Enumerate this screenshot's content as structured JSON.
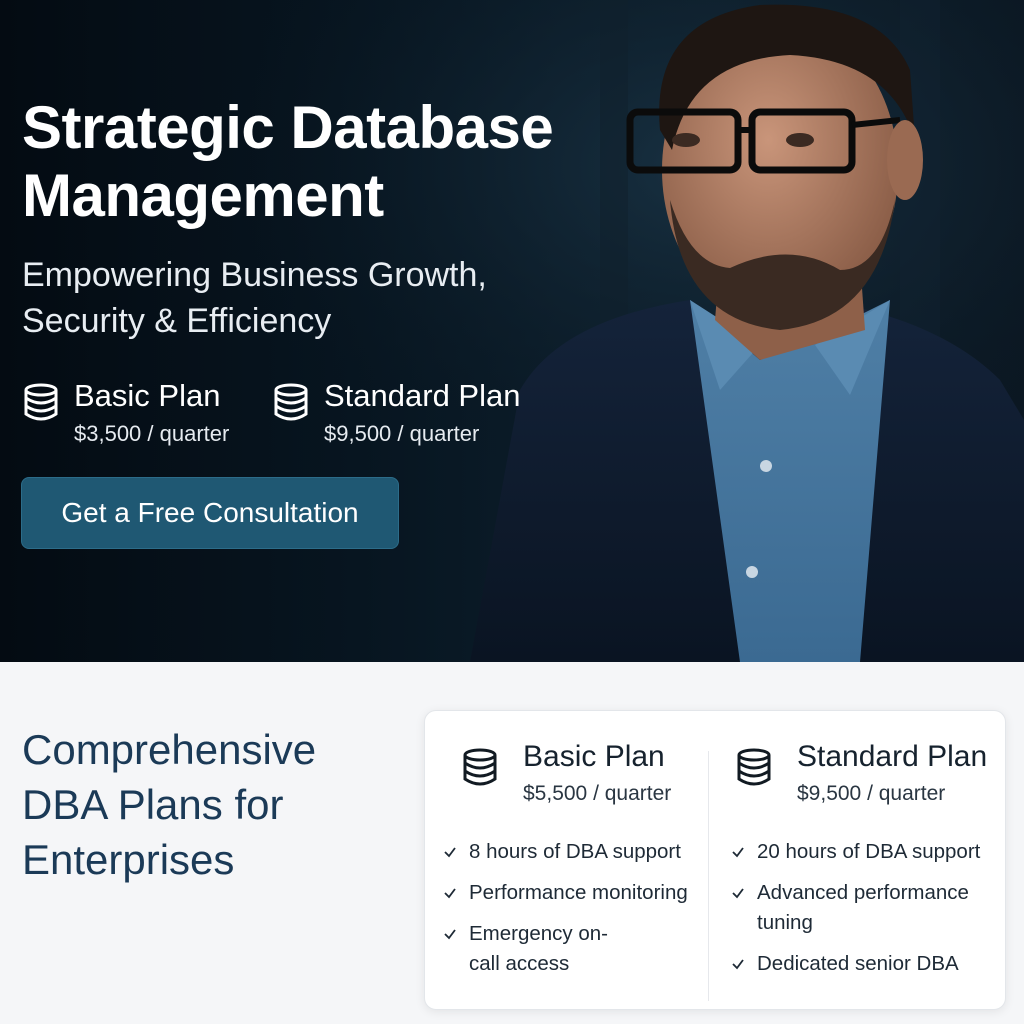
{
  "hero": {
    "title": "Strategic Database Management",
    "subtitle": "Empowering Business Growth, Security & Efficiency",
    "plans": [
      {
        "name": "Basic Plan",
        "price": "$3,500 / quarter",
        "icon": "database-icon"
      },
      {
        "name": "Standard Plan",
        "price": "$9,500 / quarter",
        "icon": "database-icon"
      }
    ],
    "cta_label": "Get a Free Consultation"
  },
  "section": {
    "title": "Comprehensive DBA Plans for Enterprises",
    "plans": [
      {
        "name": "Basic Plan",
        "price": "$5,500 / quarter",
        "icon": "database-icon",
        "features": [
          "8 hours of DBA support",
          "Performance monitoring",
          "Emergency on-call access"
        ]
      },
      {
        "name": "Standard Plan",
        "price": "$9,500 / quarter",
        "icon": "database-icon",
        "features": [
          "20 hours of DBA support",
          "Advanced performance tuning",
          "Dedicated senior DBA"
        ]
      }
    ]
  },
  "colors": {
    "hero_bg": "#071520",
    "cta_bg": "#1f5873",
    "section_title": "#1b3a57",
    "card_bg": "#ffffff"
  }
}
